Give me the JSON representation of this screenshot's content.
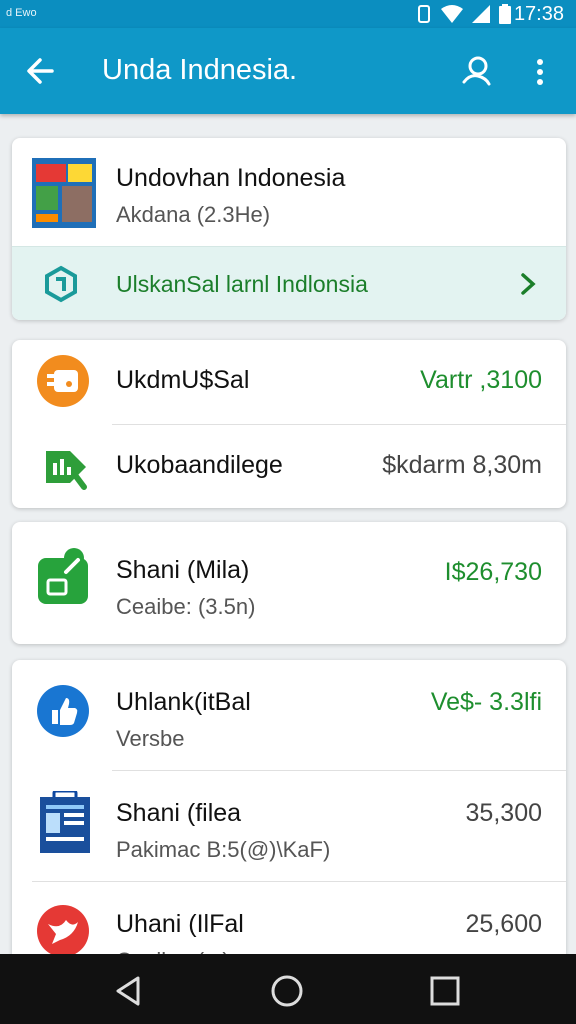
{
  "status_bar": {
    "carrier": "d Ewo",
    "time": "17:38"
  },
  "app_bar": {
    "title": "Unda Indnesia."
  },
  "header_card": {
    "title": "Undovhan Indonesia",
    "subtitle": "Akdana (2.3He)",
    "promo_label": "UlskanSal larnl Indlonsia"
  },
  "card2": {
    "rows": [
      {
        "name": "UkdmU$Sal",
        "value": "Vartr ,3100"
      },
      {
        "name": "Ukobaandilege",
        "value": "$kdarm 8,30m"
      }
    ]
  },
  "card3": {
    "name": "Shani (Mila)",
    "sub": "Ceaibe: (3.5n)",
    "value": "I$26,730"
  },
  "card4": {
    "rows": [
      {
        "name": "Uhlank(itBal",
        "sub": "Versbe",
        "value": "Ve$- 3.3lfi"
      },
      {
        "name": "Shani (filea",
        "sub": "Pakimac B:5(@)\\KaF)",
        "value": "35,300"
      },
      {
        "name": "Uhani (IlFal",
        "sub": "Ceailoo (...)",
        "value": "25,600"
      }
    ]
  },
  "colors": {
    "app_bar": "#0f98c8",
    "accent_green": "#1e8e2e",
    "promo_bg": "#e3f3f1"
  }
}
